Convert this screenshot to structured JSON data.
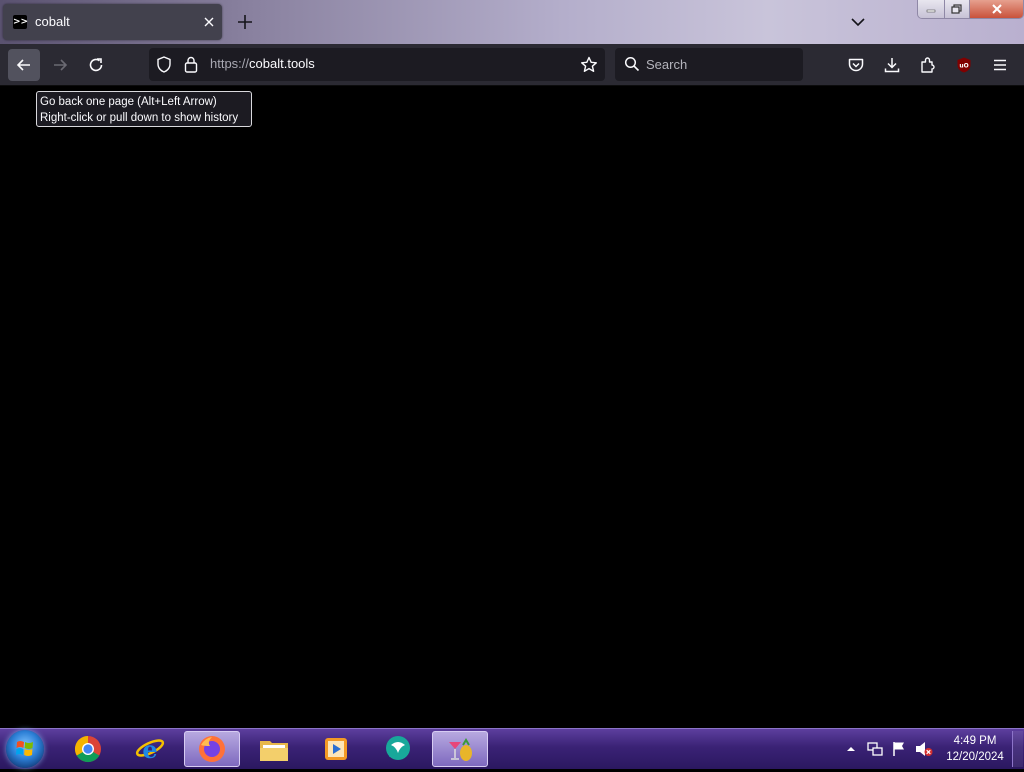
{
  "browser": {
    "tab": {
      "title": "cobalt",
      "favicon": "terminal-prompt-icon",
      "close_icon": "close-icon"
    },
    "new_tab_icon": "plus-icon",
    "tab_list_icon": "chevron-down-icon",
    "window_controls": [
      "minimize-icon",
      "restore-icon",
      "close-icon"
    ],
    "toolbar": {
      "back_icon": "arrow-left-icon",
      "forward_icon": "arrow-right-icon",
      "reload_icon": "reload-icon",
      "url": {
        "scheme": "https://",
        "host": "cobalt.tools"
      },
      "search_placeholder": "Search",
      "right_icons": [
        "pocket-icon",
        "download-icon",
        "extensions-icon",
        "ublock-origin-icon",
        "menu-icon"
      ]
    },
    "tooltip": {
      "line1": "Go back one page (Alt+Left Arrow)",
      "line2": "Right-click or pull down to show history"
    }
  },
  "taskbar": {
    "start_icon": "windows-start-icon",
    "pinned": [
      "chrome-icon",
      "internet-explorer-icon",
      "firefox-icon",
      "file-explorer-icon",
      "media-player-icon",
      "messenger-icon",
      "cocktail-app-icon"
    ],
    "tray_icons": [
      "show-hidden-icons-icon",
      "network-icon",
      "action-center-flag-icon",
      "volume-muted-icon"
    ],
    "clock": {
      "time": "4:49 PM",
      "date": "12/20/2024"
    }
  },
  "colors": {
    "toolbar_bg": "#2b2a33",
    "urlbar_bg": "#1c1b22",
    "content_bg": "#000000",
    "taskbar_accent": "#3a2275"
  }
}
